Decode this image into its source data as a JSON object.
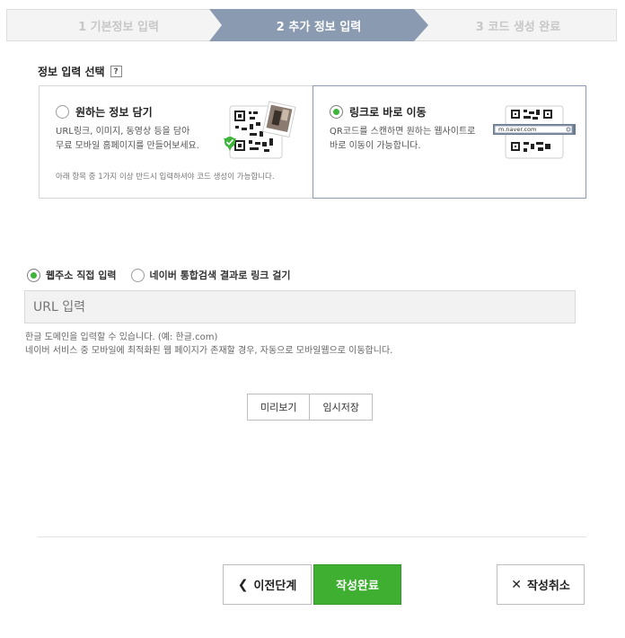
{
  "steps": [
    {
      "label": "1 기본정보 입력"
    },
    {
      "label": "2 추가 정보 입력"
    },
    {
      "label": "3 코드 생성 완료"
    }
  ],
  "section": {
    "title": "정보 입력 선택",
    "help_icon": "?"
  },
  "options": {
    "left": {
      "title": "원하는 정보 담기",
      "desc_line1": "URL링크, 이미지, 동영상 등을 담아",
      "desc_line2": "무료 모바일 홈페이지를 만들어보세요.",
      "note": "아래 항목 중 1가지 이상 반드시 입력하셔야 코드 생성이 가능합니다."
    },
    "right": {
      "title": "링크로 바로 이동",
      "desc_line1": "QR코드를 스캔하면 원하는 웹사이트로",
      "desc_line2": "바로 이동이 가능합니다.",
      "url_sample": "m.naver.com"
    }
  },
  "link_type": {
    "direct": "웹주소 직접 입력",
    "search": "네이버 통합검색 결과로 링크 걸기"
  },
  "url_input": {
    "placeholder": "URL 입력",
    "value": ""
  },
  "hint": {
    "line1": "한글 도메인을 입력할 수 있습니다. (예: 한글.com)",
    "line2": "네이버 서비스 중 모바일에 최적화된 웹 페이지가 존재할 경우, 자동으로 모바일웹으로 이동합니다."
  },
  "buttons": {
    "preview": "미리보기",
    "temp_save": "임시저장",
    "prev": "이전단계",
    "done": "작성완료",
    "cancel": "작성취소"
  },
  "colors": {
    "accent_green": "#3eaf31",
    "step_active": "#8a9ab0"
  }
}
